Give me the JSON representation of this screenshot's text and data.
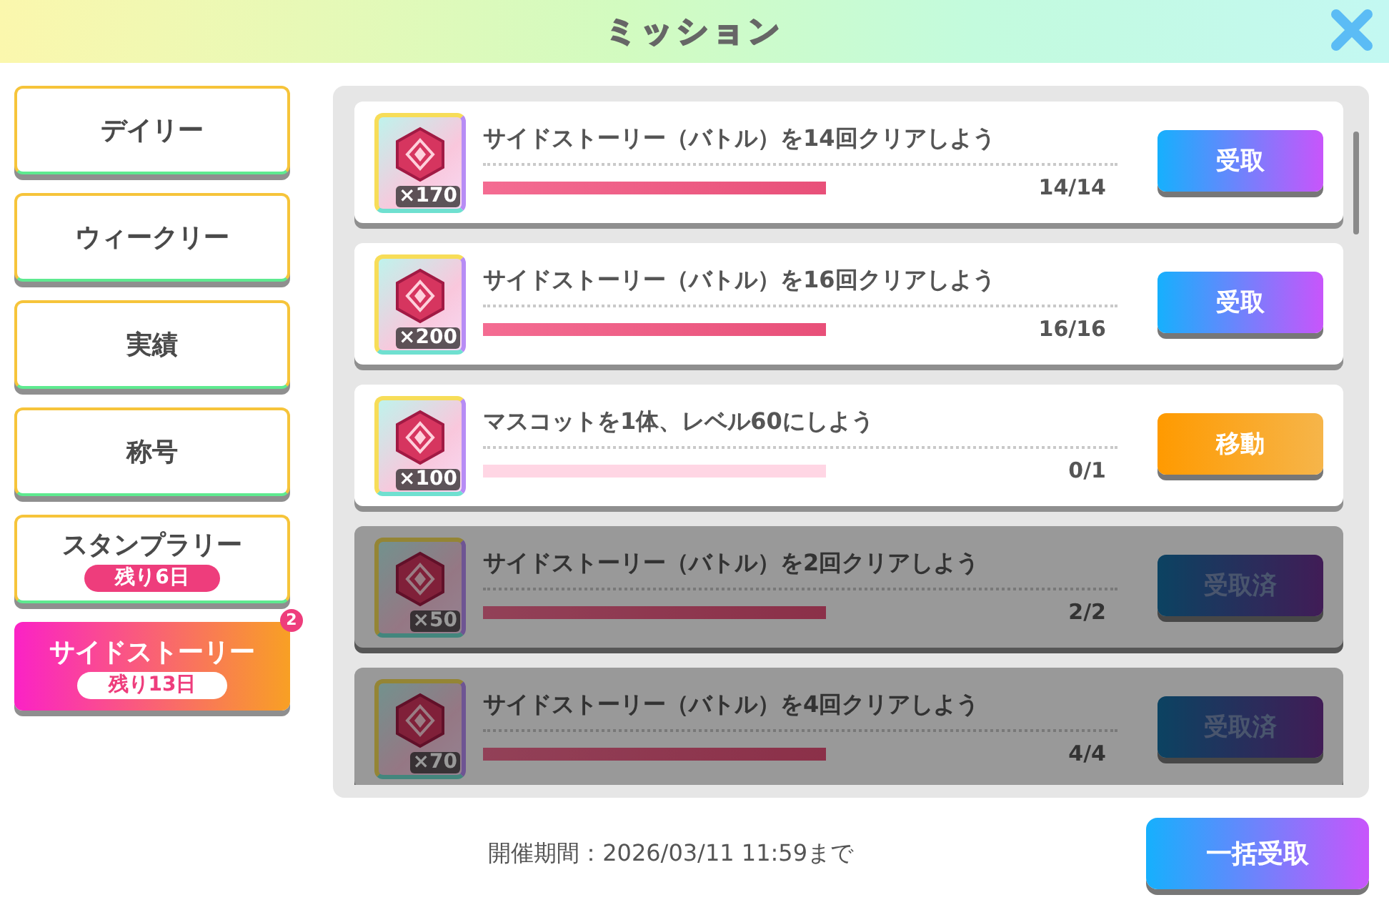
{
  "header": {
    "title": "ミッション"
  },
  "sidebar": {
    "items": [
      {
        "label": "デイリー",
        "selected": false
      },
      {
        "label": "ウィークリー",
        "selected": false
      },
      {
        "label": "実績",
        "selected": false
      },
      {
        "label": "称号",
        "selected": false
      },
      {
        "label": "スタンプラリー",
        "remaining": "残り6日",
        "selected": false
      },
      {
        "label": "サイドストーリー",
        "remaining": "残り13日",
        "badge": "2",
        "selected": true
      }
    ]
  },
  "missions": [
    {
      "reward": "×170",
      "title": "サイドストーリー（バトル）を14回クリアしよう",
      "level": 1,
      "progress": "14/14",
      "button": {
        "kind": "claim",
        "label": "受取"
      },
      "claimed": false
    },
    {
      "reward": "×200",
      "title": "サイドストーリー（バトル）を16回クリアしよう",
      "level": 1,
      "progress": "16/16",
      "button": {
        "kind": "claim",
        "label": "受取"
      },
      "claimed": false
    },
    {
      "reward": "×100",
      "title": "マスコットを1体、レベル60にしよう",
      "level": 0,
      "progress": "0/1",
      "button": {
        "kind": "go",
        "label": "移動"
      },
      "claimed": false
    },
    {
      "reward": "×50",
      "title": "サイドストーリー（バトル）を2回クリアしよう",
      "level": 1,
      "progress": "2/2",
      "button": {
        "kind": "claim",
        "label": "受取済"
      },
      "claimed": true
    },
    {
      "reward": "×70",
      "title": "サイドストーリー（バトル）を4回クリアしよう",
      "level": 1,
      "progress": "4/4",
      "button": {
        "kind": "claim",
        "label": "受取済"
      },
      "claimed": true
    }
  ],
  "footer": {
    "period": "開催期間：2026/03/11 11:59まで",
    "claim_all": "一括受取"
  }
}
